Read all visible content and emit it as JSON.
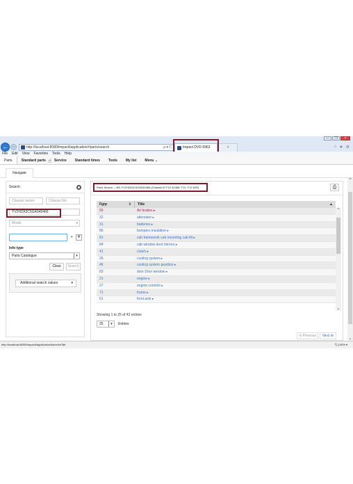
{
  "browser": {
    "address": "http://localhost:8080/impactI/application/#parts/search",
    "address_tools": "ρ ▾ C",
    "tab_active": "Impact DVD 6963",
    "tab_close": "×",
    "window_buttons": [
      "—",
      "❐",
      "×"
    ],
    "chrome_icons": [
      "⌂",
      "★",
      "⚙"
    ],
    "menu": [
      "File",
      "Edit",
      "View",
      "Favorites",
      "Tools",
      "Help"
    ],
    "status_url": "http://localhost:8080/impactI/application/#serviceTab",
    "zoom": "100%"
  },
  "appnav": [
    "Parts",
    "Standard parts",
    "Service",
    "Standard times",
    "Tools",
    "My list",
    "Menu ⌄"
  ],
  "subnav": {
    "tab": "Navigate"
  },
  "search": {
    "header": "Search",
    "chassis_series_placeholder": "Chassis series",
    "chassis_no_placeholder": "Chassis No.",
    "vin_value": "YV2HZA3C5GA049466",
    "model_placeholder": "Model",
    "info_type_label": "Info type",
    "info_type_value": "Parts Catalogue",
    "clear_label": "Clear",
    "search_label": "Search",
    "advanced_label": "Additional search values"
  },
  "results": {
    "title": "Parts Search – VIN YV2HZA3C5GA049466 (Chassis ID F12 42466; F12, F12 62R)",
    "columns": [
      "Fgrp",
      "Title"
    ],
    "rows": [
      {
        "fgrp": "56",
        "title": "Air brakes"
      },
      {
        "fgrp": "32",
        "title": "alternator"
      },
      {
        "fgrp": "31",
        "title": "batteries"
      },
      {
        "fgrp": "86",
        "title": "bumpers insulation"
      },
      {
        "fgrp": "81",
        "title": "cab framework cab mounting cab tilt"
      },
      {
        "fgrp": "84",
        "title": "cab window door mirrors"
      },
      {
        "fgrp": "41",
        "title": "clutch"
      },
      {
        "fgrp": "26",
        "title": "cooling system"
      },
      {
        "fgrp": "46",
        "title": "cooling system gearbox"
      },
      {
        "fgrp": "83",
        "title": "door Door window"
      },
      {
        "fgrp": "21",
        "title": "engine"
      },
      {
        "fgrp": "27",
        "title": "engine controls"
      },
      {
        "fgrp": "71",
        "title": "frame"
      },
      {
        "fgrp": "61",
        "title": "front axle"
      }
    ],
    "info": "Showing 1 to 25 of 42 entries",
    "page_size": "25",
    "entries_label": "Entries",
    "prev_label": "Previous",
    "next_label": "Next"
  },
  "colors": {
    "highlight_box": "#7a1c2a",
    "link": "#3a74c0",
    "selected_row_text": "#c2185b"
  }
}
